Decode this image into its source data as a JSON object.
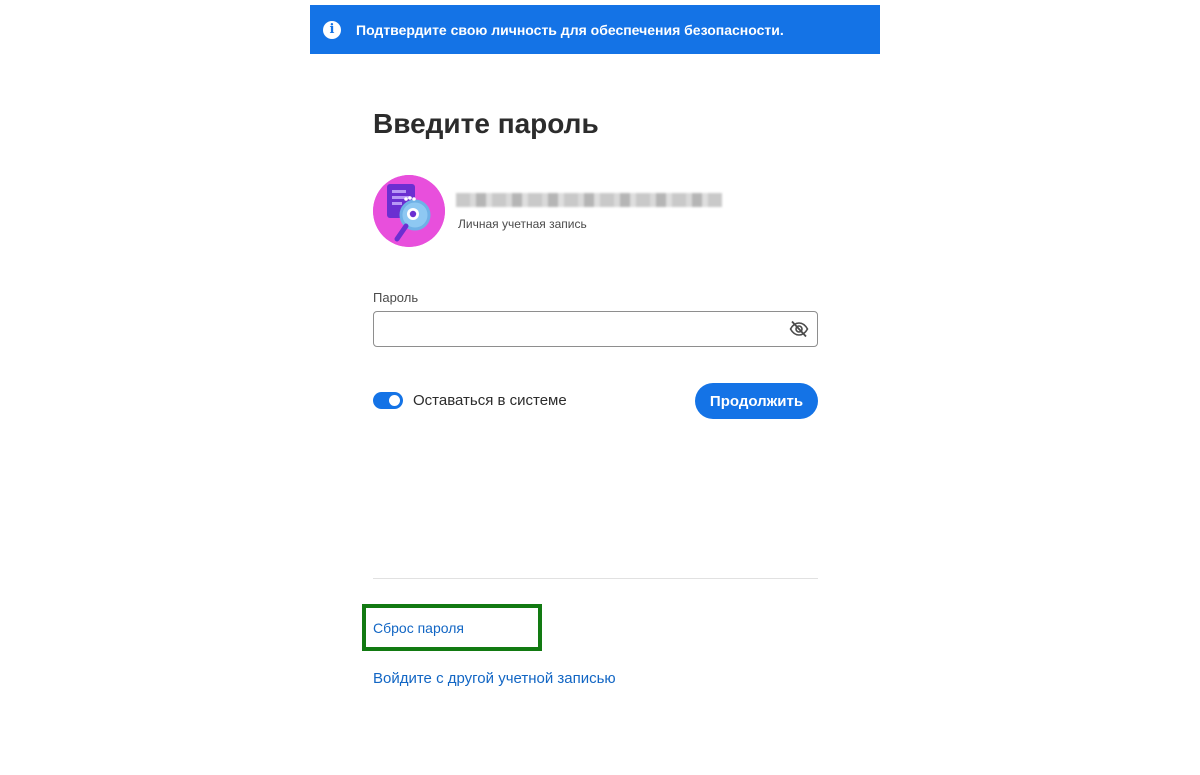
{
  "banner": {
    "icon": "info-icon",
    "text": "Подтвердите свою личность для обеспечения безопасности."
  },
  "page_title": "Введите пароль",
  "account": {
    "avatar_icon": "avatar-illustration",
    "type_label": "Личная учетная запись"
  },
  "password": {
    "label": "Пароль",
    "value": "",
    "toggle_icon": "eye-slash-icon"
  },
  "stay_signed_in": {
    "label": "Оставаться в системе",
    "enabled": true
  },
  "continue_label": "Продолжить",
  "links": {
    "reset_password": "Сброс пароля",
    "other_account": "Войдите с другой учетной записью"
  },
  "colors": {
    "accent": "#1473e6",
    "highlight": "#127a12",
    "avatar_bg": "#e84fdc"
  }
}
